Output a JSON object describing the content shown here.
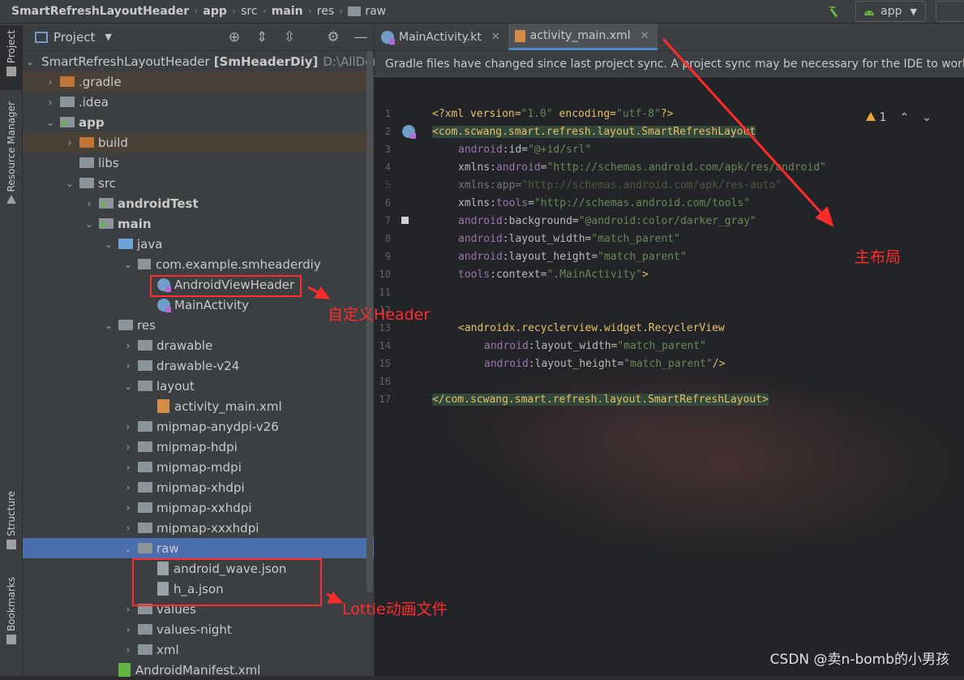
{
  "breadcrumb": {
    "project": "SmartRefreshLayoutHeader",
    "items": [
      "app",
      "src",
      "main",
      "res",
      "raw"
    ]
  },
  "toolbar": {
    "run_config": "app"
  },
  "left_strip": {
    "project_tab": "Project",
    "resource_tab": "Resource Manager",
    "structure_tab": "Structure",
    "bookmarks_tab": "Bookmarks"
  },
  "project_panel": {
    "title": "Project",
    "root_name": "SmartRefreshLayoutHeader",
    "root_module": "[SmHeaderDiy]",
    "root_path": "D:\\AllDemo",
    "tree": [
      {
        "label": ".gradle"
      },
      {
        "label": ".idea"
      },
      {
        "label": "app"
      },
      {
        "label": "build"
      },
      {
        "label": "libs"
      },
      {
        "label": "src"
      },
      {
        "label": "androidTest"
      },
      {
        "label": "main"
      },
      {
        "label": "java"
      },
      {
        "label": "com.example.smheaderdiy"
      },
      {
        "label": "AndroidViewHeader"
      },
      {
        "label": "MainActivity"
      },
      {
        "label": "res"
      },
      {
        "label": "drawable"
      },
      {
        "label": "drawable-v24"
      },
      {
        "label": "layout"
      },
      {
        "label": "activity_main.xml"
      },
      {
        "label": "mipmap-anydpi-v26"
      },
      {
        "label": "mipmap-hdpi"
      },
      {
        "label": "mipmap-mdpi"
      },
      {
        "label": "mipmap-xhdpi"
      },
      {
        "label": "mipmap-xxhdpi"
      },
      {
        "label": "mipmap-xxxhdpi"
      },
      {
        "label": "raw"
      },
      {
        "label": "android_wave.json"
      },
      {
        "label": "h_a.json"
      },
      {
        "label": "values"
      },
      {
        "label": "values-night"
      },
      {
        "label": "xml"
      },
      {
        "label": "AndroidManifest.xml"
      }
    ]
  },
  "editor": {
    "tabs": [
      {
        "label": "MainActivity.kt"
      },
      {
        "label": "activity_main.xml"
      }
    ],
    "notice": "Gradle files have changed since last project sync. A project sync may be necessary for the IDE to work prope",
    "warning_count": "1",
    "line_numbers": [
      "1",
      "2",
      "3",
      "4",
      "5",
      "6",
      "7",
      "8",
      "9",
      "10",
      "11",
      "12",
      "13",
      "14",
      "15",
      "16",
      "17"
    ],
    "code": {
      "l1a": "<?xml version=",
      "l1b": "\"1.0\"",
      "l1c": " encoding=",
      "l1d": "\"utf-8\"",
      "l1e": "?>",
      "l2": "<com.scwang.smart.refresh.layout.SmartRefreshLayout",
      "l3a": "android",
      "l3b": ":id=",
      "l3c": "\"@+id/srl\"",
      "l4a": "xmlns:",
      "l4b": "android",
      "l4c": "=",
      "l4d": "\"http://schemas.android.com/apk/res/android\"",
      "l5a": "xmlns:app=",
      "l5b": "\"http://schemas.android.com/apk/res-auto\"",
      "l6a": "xmlns:",
      "l6b": "tools",
      "l6c": "=",
      "l6d": "\"http://schemas.android.com/tools\"",
      "l7a": "android",
      "l7b": ":background=",
      "l7c": "\"@android:color/darker_gray\"",
      "l8a": "android",
      "l8b": ":layout_width=",
      "l8c": "\"match_parent\"",
      "l9a": "android",
      "l9b": ":layout_height=",
      "l9c": "\"match_parent\"",
      "l10a": "tools",
      "l10b": ":context=",
      "l10c": "\".MainActivity\"",
      "l10d": ">",
      "l13": "<androidx.recyclerview.widget.RecyclerView",
      "l14a": "android",
      "l14b": ":layout_width=",
      "l14c": "\"match_parent\"",
      "l15a": "android",
      "l15b": ":layout_height=",
      "l15c": "\"match_parent\"",
      "l15d": "/>",
      "l17": "</com.scwang.smart.refresh.layout.SmartRefreshLayout>"
    }
  },
  "annotations": {
    "custom_header": "自定义Header",
    "main_layout": "主布局",
    "lottie": "Lottie动画文件",
    "color": "#ff2b2b"
  },
  "watermark": "CSDN @卖n-bomb的小男孩"
}
